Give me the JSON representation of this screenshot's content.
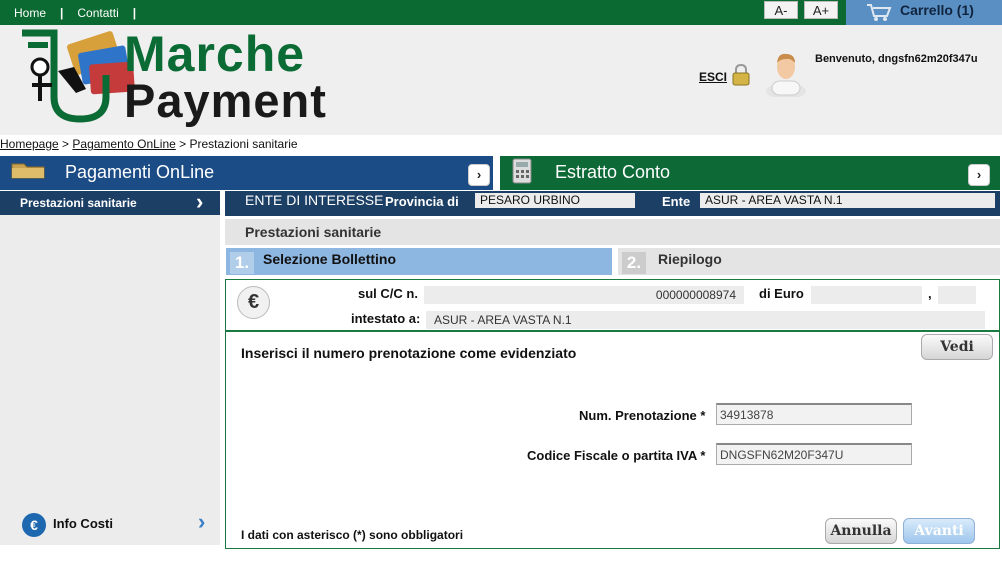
{
  "topnav": {
    "home": "Home",
    "contatti": "Contatti",
    "sep": "|"
  },
  "font_controls": {
    "decrease": "A-",
    "increase": "A+"
  },
  "cart": {
    "label": "Carrello (1)"
  },
  "brand": {
    "line1": "Marche",
    "line2": "Payment"
  },
  "user": {
    "logout": "ESCI",
    "welcome": "Benvenuto, dngsfn62m20f347u"
  },
  "breadcrumb": {
    "home": "Homepage",
    "sep1": " > ",
    "online": "Pagamento OnLine",
    "sep2": " > ",
    "current": "Prestazioni sanitarie"
  },
  "sections": {
    "pagamenti": "Pagamenti OnLine",
    "estratto": "Estratto Conto",
    "arrow": "›"
  },
  "sidebar": {
    "active_item": "Prestazioni sanitarie",
    "chevron": "›",
    "info_costi": "Info Costi"
  },
  "ente": {
    "title": "ENTE DI INTERESSE",
    "provincia_label": "Provincia di",
    "provincia_value": "PESARO URBINO",
    "ente_label": "Ente",
    "ente_value": "ASUR - AREA VASTA N.1"
  },
  "page": {
    "section_title": "Prestazioni sanitarie"
  },
  "steps": [
    {
      "num": "1.",
      "label": "Selezione Bollettino"
    },
    {
      "num": "2.",
      "label": "Riepilogo"
    }
  ],
  "bollettino": {
    "euro_symbol": "€",
    "cc_label": "sul C/C n.",
    "cc_value": "000000008974",
    "euro_label": "di Euro",
    "euro_int": "",
    "comma": ",",
    "euro_dec": "",
    "intestato_label": "intestato a:",
    "intestato_value": "ASUR - AREA VASTA N.1"
  },
  "form": {
    "instructions": "Inserisci il numero prenotazione come evidenziato",
    "vedi": "Vedi",
    "prenotazione_label": "Num. Prenotazione *",
    "prenotazione_value": "34913878",
    "cf_label": "Codice Fiscale o partita IVA *",
    "cf_value": "DNGSFN62M20F347U",
    "note": "I dati con asterisco (*) sono obbligatori",
    "annulla": "Annulla",
    "avanti": "Avanti"
  }
}
